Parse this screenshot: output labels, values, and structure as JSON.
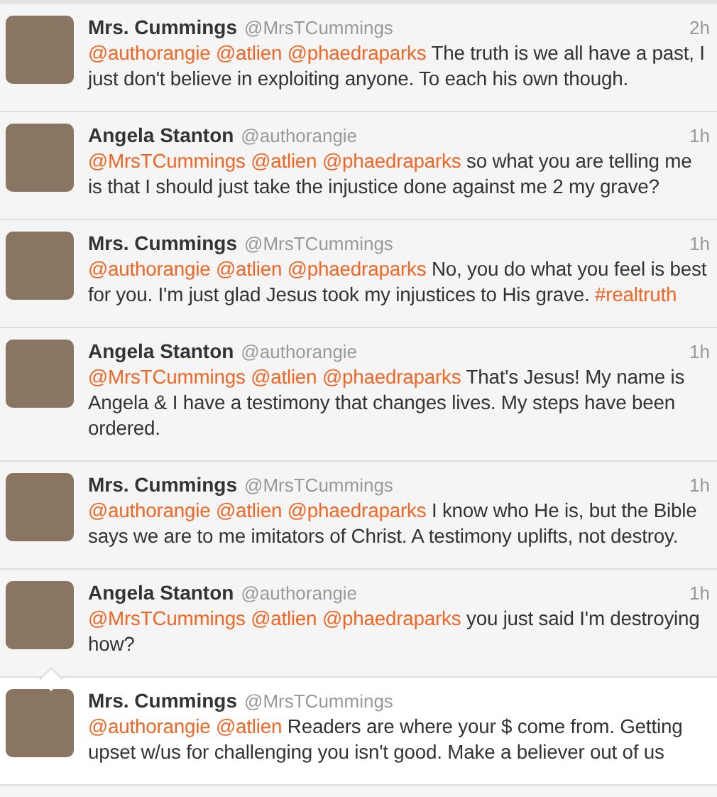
{
  "tweets": [
    {
      "name": "Mrs. Cummings",
      "handle": "@MrsTCummings",
      "time": "2h",
      "selected": false,
      "parts": [
        {
          "kind": "mention",
          "text": "@authorangie"
        },
        {
          "kind": "mention",
          "text": "@atlien"
        },
        {
          "kind": "mention",
          "text": "@phaedraparks"
        },
        {
          "kind": "text",
          "text": "The truth is we all have a past, I just don't believe in exploiting anyone. To each his own though."
        }
      ]
    },
    {
      "name": "Angela Stanton",
      "handle": "@authorangie",
      "time": "1h",
      "selected": false,
      "parts": [
        {
          "kind": "mention",
          "text": "@MrsTCummings"
        },
        {
          "kind": "mention",
          "text": "@atlien"
        },
        {
          "kind": "mention",
          "text": "@phaedraparks"
        },
        {
          "kind": "text",
          "text": "so what you are telling me is that I should just take the injustice done against me 2 my grave?"
        }
      ]
    },
    {
      "name": "Mrs. Cummings",
      "handle": "@MrsTCummings",
      "time": "1h",
      "selected": false,
      "parts": [
        {
          "kind": "mention",
          "text": "@authorangie"
        },
        {
          "kind": "mention",
          "text": "@atlien"
        },
        {
          "kind": "mention",
          "text": "@phaedraparks"
        },
        {
          "kind": "text",
          "text": "No, you do what you feel is best for you. I'm just glad Jesus took my injustices to His grave."
        },
        {
          "kind": "mention",
          "text": "#realtruth"
        }
      ]
    },
    {
      "name": "Angela Stanton",
      "handle": "@authorangie",
      "time": "1h",
      "selected": false,
      "parts": [
        {
          "kind": "mention",
          "text": "@MrsTCummings"
        },
        {
          "kind": "mention",
          "text": "@atlien"
        },
        {
          "kind": "mention",
          "text": "@phaedraparks"
        },
        {
          "kind": "text",
          "text": "That's Jesus! My name is Angela & I have a testimony that changes lives. My steps have been ordered."
        }
      ]
    },
    {
      "name": "Mrs. Cummings",
      "handle": "@MrsTCummings",
      "time": "1h",
      "selected": false,
      "parts": [
        {
          "kind": "mention",
          "text": "@authorangie"
        },
        {
          "kind": "mention",
          "text": "@atlien"
        },
        {
          "kind": "mention",
          "text": "@phaedraparks"
        },
        {
          "kind": "text",
          "text": "I know who He is, but the Bible says we are to me imitators of Christ. A testimony uplifts, not destroy."
        }
      ]
    },
    {
      "name": "Angela Stanton",
      "handle": "@authorangie",
      "time": "1h",
      "selected": false,
      "parts": [
        {
          "kind": "mention",
          "text": "@MrsTCummings"
        },
        {
          "kind": "mention",
          "text": "@atlien"
        },
        {
          "kind": "mention",
          "text": "@phaedraparks"
        },
        {
          "kind": "text",
          "text": "you just said I'm destroying how?"
        }
      ]
    },
    {
      "name": "Mrs. Cummings",
      "handle": "@MrsTCummings",
      "selected": true,
      "parts": [
        {
          "kind": "mention",
          "text": "@authorangie"
        },
        {
          "kind": "mention",
          "text": "@atlien"
        },
        {
          "kind": "text",
          "text": "Readers are where your $ come from. Getting upset w/us for challenging you isn't good. Make a believer out of us"
        }
      ]
    }
  ]
}
